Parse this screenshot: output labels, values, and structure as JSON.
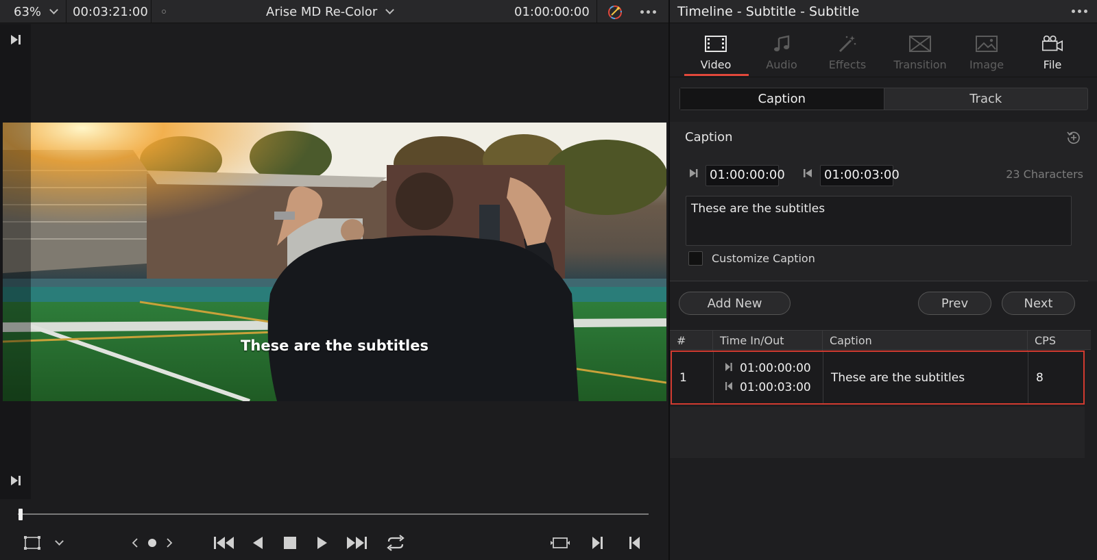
{
  "viewer": {
    "zoom": "63%",
    "timecode_duration": "00:03:21:00",
    "clip_name": "Arise MD Re-Color",
    "timecode_current": "01:00:00:00",
    "subtitle_overlay": "These are the subtitles",
    "scrubber_position": 0.0,
    "icons": [
      "skip-to-start-icon",
      "skip-to-end-icon",
      "magic-mask-icon",
      "more-options-icon",
      "crop-icon",
      "chevron-down-icon",
      "prev-arrow-icon",
      "nav-dot-icon",
      "next-arrow-icon",
      "jump-first-frame-icon",
      "step-back-icon",
      "stop-icon",
      "play-icon",
      "jump-last-frame-icon",
      "loop-icon",
      "match-frame-icon",
      "mark-in-icon",
      "mark-out-icon"
    ]
  },
  "inspector": {
    "title": "Timeline - Subtitle - Subtitle",
    "tabs": [
      {
        "label": "Video",
        "icon": "film-icon",
        "state": "active"
      },
      {
        "label": "Audio",
        "icon": "music-note-icon",
        "state": "disabled"
      },
      {
        "label": "Effects",
        "icon": "magic-wand-icon",
        "state": "disabled"
      },
      {
        "label": "Transition",
        "icon": "transition-icon",
        "state": "disabled"
      },
      {
        "label": "Image",
        "icon": "image-icon",
        "state": "disabled"
      },
      {
        "label": "File",
        "icon": "file-icon",
        "state": "enabled"
      }
    ],
    "segments": [
      "Caption",
      "Track"
    ],
    "caption": {
      "heading": "Caption",
      "time_in": "01:00:00:00",
      "time_out": "01:00:03:00",
      "char_count": "23 Characters",
      "text": "These are the subtitles",
      "customize_label": "Customize Caption",
      "customize_checked": false
    },
    "buttons": {
      "add_new": "Add New",
      "prev": "Prev",
      "next": "Next"
    },
    "table": {
      "headers": [
        "#",
        "Time In/Out",
        "Caption",
        "CPS"
      ],
      "rows": [
        {
          "index": "1",
          "time_in": "01:00:00:00",
          "time_out": "01:00:03:00",
          "caption": "These are the subtitles",
          "cps": "8"
        }
      ]
    }
  },
  "colors": {
    "accent": "#e2483b",
    "selection_border": "#d23b30",
    "background": "#1b1b1d",
    "panel": "#28282a"
  }
}
